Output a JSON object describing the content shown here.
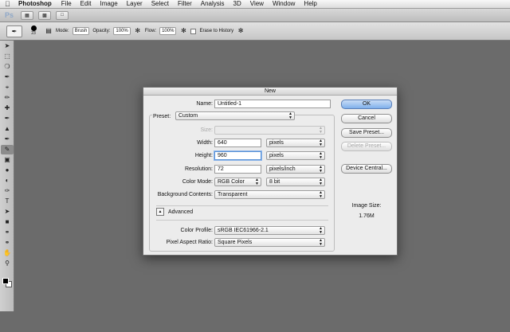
{
  "menubar": {
    "items": [
      "Photoshop",
      "File",
      "Edit",
      "Image",
      "Layer",
      "Select",
      "Filter",
      "Analysis",
      "3D",
      "View",
      "Window",
      "Help"
    ]
  },
  "appbar": {
    "logo": "Ps"
  },
  "options": {
    "brush_size": "23",
    "mode_label": "Mode:",
    "mode_value": "Brush",
    "opacity_label": "Opacity:",
    "opacity_value": "100%",
    "flow_label": "Flow:",
    "flow_value": "100%",
    "erase_label": "Erase to History"
  },
  "dialog": {
    "title": "New",
    "name_label": "Name:",
    "name_value": "Untitled-1",
    "preset_label": "Preset:",
    "preset_value": "Custom",
    "size_label": "Size:",
    "width_label": "Width:",
    "width_value": "640",
    "width_unit": "pixels",
    "height_label": "Height:",
    "height_value": "960",
    "height_unit": "pixels",
    "resolution_label": "Resolution:",
    "resolution_value": "72",
    "resolution_unit": "pixels/inch",
    "color_mode_label": "Color Mode:",
    "color_mode_value": "RGB Color",
    "bit_depth": "8 bit",
    "bg_label": "Background Contents:",
    "bg_value": "Transparent",
    "advanced_label": "Advanced",
    "color_profile_label": "Color Profile:",
    "color_profile_value": "sRGB IEC61966-2.1",
    "aspect_label": "Pixel Aspect Ratio:",
    "aspect_value": "Square Pixels",
    "buttons": {
      "ok": "OK",
      "cancel": "Cancel",
      "save_preset": "Save Preset...",
      "delete_preset": "Delete Preset...",
      "device_central": "Device Central..."
    },
    "image_size_label": "Image Size:",
    "image_size_value": "1.76M"
  },
  "colors": {
    "canvas": "#6b6b6b",
    "ok_button": "#7fb0ec",
    "focus_ring": "#5b92d6"
  }
}
